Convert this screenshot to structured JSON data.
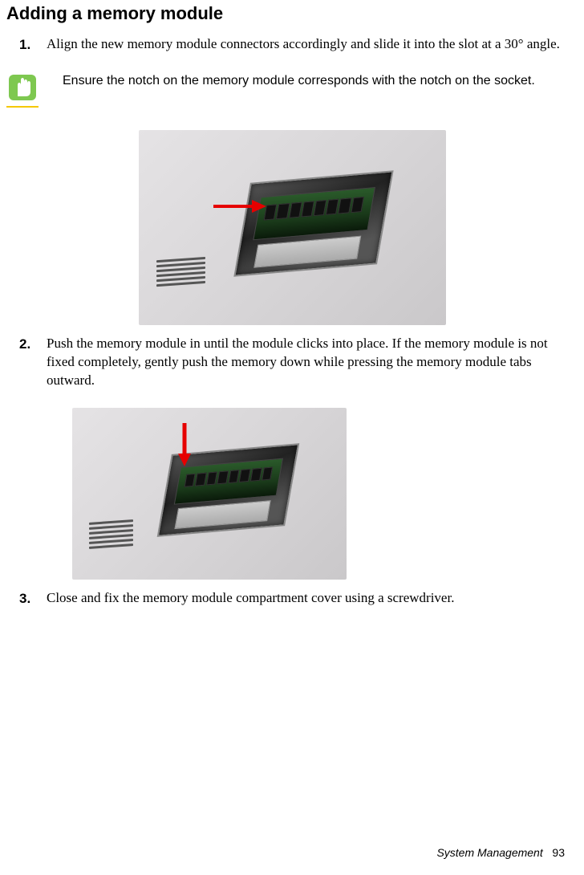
{
  "heading": "Adding a memory module",
  "steps": {
    "s1": {
      "num": "1.",
      "text": "Align the new memory module connectors accordingly and slide it into the slot at a 30° angle."
    },
    "s2": {
      "num": "2.",
      "text": "Push the memory module in until the module clicks into place. If the memory module is not fixed completely, gently push the memory down while pressing the memory module tabs outward."
    },
    "s3": {
      "num": "3.",
      "text": "Close and fix the memory module compartment cover using a screwdriver."
    }
  },
  "caution": {
    "text": "Ensure the notch on the memory module corresponds with the notch on the socket.",
    "icon_name": "caution-hand-icon"
  },
  "figures": {
    "fig1": {
      "alt": "Laptop underside with memory slot open, memory module inserted at angle, red arrow pointing right indicating slide direction"
    },
    "fig2": {
      "alt": "Laptop underside with memory module in slot, red arrow pointing down indicating press direction"
    }
  },
  "footer": {
    "chapter": "System Management",
    "page": "93"
  }
}
